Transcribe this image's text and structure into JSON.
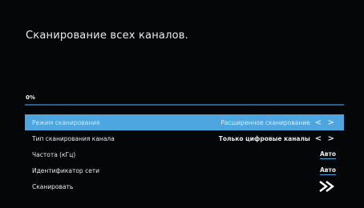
{
  "page": {
    "title": "Сканирование всех каналов."
  },
  "progress": {
    "label": "0%",
    "value": 0
  },
  "menu": {
    "items": [
      {
        "label": "Режим сканирования",
        "value": "Расширенное сканирование",
        "arrows": "< >"
      },
      {
        "label": "Тип сканирования канала",
        "value": "Только цифровые каналы",
        "arrows": "< >"
      },
      {
        "label": "Частота (кГц)",
        "value": "Авто"
      },
      {
        "label": "Идентификатор сети",
        "value": "Авто"
      },
      {
        "label": "Сканировать",
        "icon": "double-chevron-right-icon"
      }
    ]
  },
  "colors": {
    "background": "#050607",
    "highlight": "#4ea6e0",
    "progress_track": "#2a5f8a",
    "text": "#e6e9ec"
  }
}
